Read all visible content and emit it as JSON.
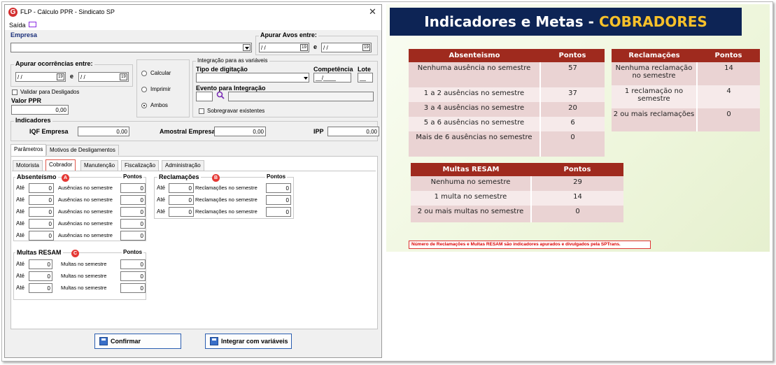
{
  "window": {
    "title": "FLP - Cálculo PPR - Sindicato SP",
    "close": "✕",
    "menu_saida": "Saída"
  },
  "empresa": {
    "label": "Empresa",
    "value": ""
  },
  "apurar_avos": {
    "label": "Apurar Avos entre:",
    "from": "/ /",
    "e": "e",
    "to": "/ /"
  },
  "apurar_ocorrencias": {
    "label": "Apurar ocorrências entre:",
    "from": "/ /",
    "e": "e",
    "to": "/ /"
  },
  "validar_label": "Validar para Desligados",
  "valor_ppr": {
    "label": "Valor PPR",
    "value": "0,00"
  },
  "radio": {
    "calcular": "Calcular",
    "imprimir": "Imprimir",
    "ambos": "Ambos"
  },
  "integracao": {
    "group": "Integração para as variáveis",
    "tipo_digitacao": "Tipo de digitação",
    "competencia": "Competência",
    "competencia_value": "__/____",
    "lote": "Lote",
    "lote_value": "__",
    "evento": "Evento para Integração",
    "sobregravar": "Sobregravar existentes"
  },
  "indicadores": {
    "group": "Indicadores",
    "iqf_label": "IQF Empresa",
    "iqf_value": "0,00",
    "amostral_label": "Amostral Empresa",
    "amostral_value": "0,00",
    "ipp_label": "IPP",
    "ipp_value": "0,00"
  },
  "tabs_outer": [
    "Parâmetros",
    "Motivos de Desligamentos"
  ],
  "tabs_inner": [
    "Motorista",
    "Cobrador",
    "Manutenção",
    "Fiscalização",
    "Administração"
  ],
  "absenteismo": {
    "title": "Absenteísmo",
    "badge": "A",
    "pontos": "Pontos",
    "ate": "Até",
    "rows": [
      {
        "val": "0",
        "label": "Ausências no semestre",
        "pts": "0"
      },
      {
        "val": "0",
        "label": "Ausências no semestre",
        "pts": "0"
      },
      {
        "val": "0",
        "label": "Ausências no semestre",
        "pts": "0"
      },
      {
        "val": "0",
        "label": "Ausências no semestre",
        "pts": "0"
      },
      {
        "val": "0",
        "label": "Ausências no semestre",
        "pts": "0"
      }
    ]
  },
  "reclamacoes": {
    "title": "Reclamações",
    "badge": "B",
    "pontos": "Pontos",
    "ate": "Até",
    "rows": [
      {
        "val": "0",
        "label": "Reclamações no semestre",
        "pts": "0"
      },
      {
        "val": "0",
        "label": "Reclamações no semestre",
        "pts": "0"
      },
      {
        "val": "0",
        "label": "Reclamações no semestre",
        "pts": "0"
      }
    ]
  },
  "multas": {
    "title": "Multas RESAM",
    "badge": "C",
    "pontos": "Pontos",
    "ate": "Até",
    "rows": [
      {
        "val": "0",
        "label": "Multas no semestre",
        "pts": "0"
      },
      {
        "val": "0",
        "label": "Multas no semestre",
        "pts": "0"
      },
      {
        "val": "0",
        "label": "Multas no semestre",
        "pts": "0"
      }
    ]
  },
  "buttons": {
    "confirmar": "Confirmar",
    "integrar": "Integrar com variáveis"
  },
  "slide": {
    "title_main": "Indicadores e Metas - ",
    "title_accent": "COBRADORES",
    "abs_table": {
      "h1": "Absenteismo",
      "h2": "Pontos",
      "rows": [
        {
          "desc": "Nenhuma ausência no semestre",
          "pts": "57"
        },
        {
          "desc": "1 a 2 ausências no semestre",
          "pts": "37"
        },
        {
          "desc": "3 a 4 ausências no semestre",
          "pts": "20"
        },
        {
          "desc": "5 a 6 ausências no semestre",
          "pts": "6"
        },
        {
          "desc": "Mais de 6 ausências no semestre",
          "pts": "0"
        }
      ]
    },
    "rec_table": {
      "h1": "Reclamações",
      "h2": "Pontos",
      "rows": [
        {
          "desc": "Nenhuma reclamação no semestre",
          "pts": "14"
        },
        {
          "desc": "1 reclamação no semestre",
          "pts": "4"
        },
        {
          "desc": "2 ou mais reclamações",
          "pts": "0"
        }
      ]
    },
    "mul_table": {
      "h1": "Multas RESAM",
      "h2": "Pontos",
      "rows": [
        {
          "desc": "Nenhuma no semestre",
          "pts": "29"
        },
        {
          "desc": "1 multa no semestre",
          "pts": "14"
        },
        {
          "desc": "2 ou mais multas no semestre",
          "pts": "0"
        }
      ]
    },
    "note": "Número de Reclamações e Multas RESAM são indicadores apurados e divulgados pela SPTrans."
  },
  "colors": {
    "header": "#0d2455",
    "accent": "#f7c12a",
    "table_head": "#9f2a1e",
    "badge": "#e53935"
  }
}
